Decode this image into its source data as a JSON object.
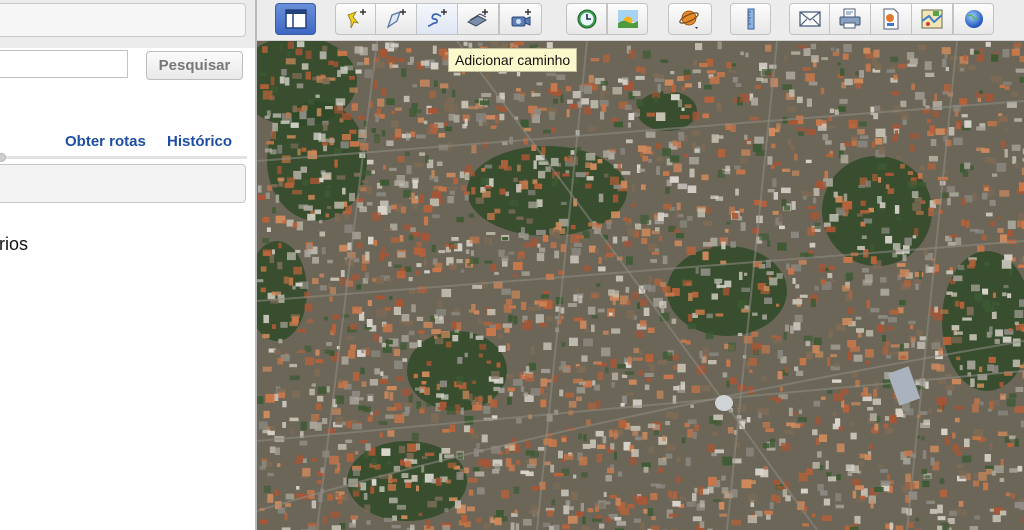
{
  "sidebar": {
    "search_button": "Pesquisar",
    "links": {
      "routes": "Obter rotas",
      "history": "Histórico"
    },
    "partial_label": "rios"
  },
  "toolbar": {
    "tooltip": "Adicionar caminho",
    "buttons": [
      "sidebar-toggle",
      "add-placemark",
      "add-polygon",
      "add-path",
      "add-image-overlay",
      "record-tour",
      "historical-imagery",
      "sun",
      "switch-planet",
      "ruler",
      "email",
      "print",
      "save-image",
      "view-in-maps",
      "google-earth"
    ]
  },
  "map": {
    "type": "satellite-imagery"
  },
  "colors": {
    "link": "#1d4ea3",
    "active_button": "#4a72c8",
    "tooltip_bg": "#fbf9cc"
  }
}
